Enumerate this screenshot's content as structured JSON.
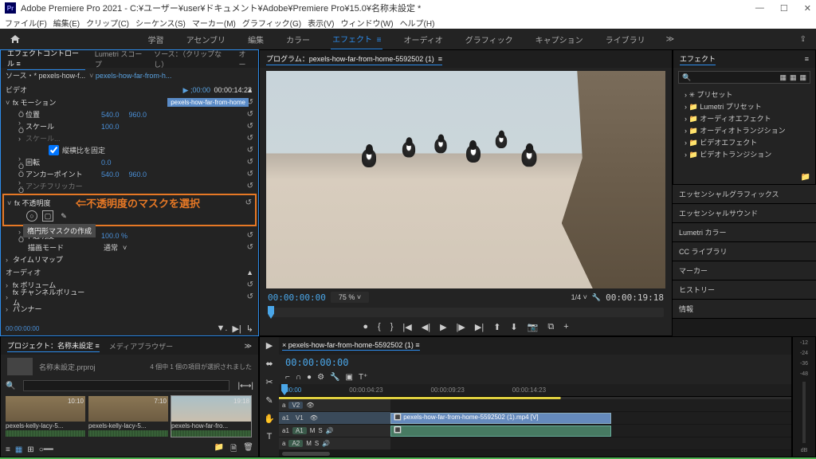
{
  "titlebar": {
    "app_icon": "Pr",
    "title": "Adobe Premiere Pro 2021 - C:¥ユーザー¥user¥ドキュメント¥Adobe¥Premiere Pro¥15.0¥名称未設定 *"
  },
  "menu": [
    "ファイル(F)",
    "編集(E)",
    "クリップ(C)",
    "シーケンス(S)",
    "マーカー(M)",
    "グラフィック(G)",
    "表示(V)",
    "ウィンドウ(W)",
    "ヘルプ(H)"
  ],
  "workspaces": {
    "items": [
      "学習",
      "アセンブリ",
      "編集",
      "カラー",
      "エフェクト",
      "オーディオ",
      "グラフィック",
      "キャプション",
      "ライブラリ"
    ],
    "active": "エフェクト"
  },
  "ec": {
    "tabs": [
      "エフェクトコントロール",
      "Lumetri スコープ",
      "ソース：（クリップなし）",
      "オー"
    ],
    "source_prefix": "ソース・* pexels-how-f...",
    "source_clip": "pexels-how-far-from-h...",
    "tc_start": "▶ ;00:00",
    "tc_end": "00:00:14:23",
    "clip_marker": "pexels-how-far-from-home",
    "video_hdr": "ビデオ",
    "motion": {
      "label": "fx モーション",
      "position": {
        "label": "位置",
        "x": "540.0",
        "y": "960.0"
      },
      "scale": {
        "label": "スケール",
        "value": "100.0"
      },
      "scale_w": {
        "label": "スケール...",
        "value": ""
      },
      "uniform": {
        "label": "縦横比を固定"
      },
      "rotation": {
        "label": "回転",
        "value": "0.0"
      },
      "anchor": {
        "label": "アンカーポイント",
        "x": "540.0",
        "y": "960.0"
      },
      "antiflicker": {
        "label": "アンチフリッカー",
        "value": ""
      }
    },
    "opacity": {
      "label": "fx 不透明度",
      "annotation": "⇐不透明度のマスクを選択",
      "tooltip": "楕円形マスクの作成",
      "value_label": "不透明度",
      "value": "100.0 %",
      "blend_label": "描画モード",
      "blend": "通常"
    },
    "timeremap": {
      "label": "タイムリマップ"
    },
    "audio_hdr": "オーディオ",
    "volume": {
      "label": "fx ボリューム"
    },
    "channel_volume": {
      "label": "fx チャンネルボリューム"
    },
    "panner": {
      "label": "パンナー"
    },
    "footer_tc": "00:00:00:00"
  },
  "program": {
    "tab": "プログラム：pexels-how-far-from-home-5592502 (1)",
    "tc_current": "00:00:00:00",
    "zoom": "75 %",
    "frac": "1/4",
    "tc_dur": "00:00:19:18"
  },
  "effects": {
    "tab": "エフェクト",
    "search_ph": "",
    "tree": [
      "プリセット",
      "Lumetri プリセット",
      "オーディオエフェクト",
      "オーディオトランジション",
      "ビデオエフェクト",
      "ビデオトランジション"
    ]
  },
  "side_panels": [
    "エッセンシャルグラフィックス",
    "エッセンシャルサウンド",
    "Lumetri カラー",
    "CC ライブラリ",
    "マーカー",
    "ヒストリー",
    "情報"
  ],
  "project": {
    "tabs": [
      "プロジェクト：名称未設定",
      "メディアブラウザー"
    ],
    "name": "名称未設定.prproj",
    "count": "4 個中 1 個の項目が選択されました",
    "clips": [
      {
        "name": "pexels-kelly-lacy-5...",
        "dur": "10:10"
      },
      {
        "name": "pexels-kelly-lacy-5...",
        "dur": "7:10"
      },
      {
        "name": "pexels-how-far-fro...",
        "dur": "19:18"
      }
    ]
  },
  "timeline": {
    "tab": "pexels-how-far-from-home-5592502 (1)",
    "tc": "00:00:00:00",
    "ruler": [
      ":00:00",
      "00:00:04:23",
      "00:00:09:23",
      "00:00:14:23"
    ],
    "tracks": {
      "v2": "V2",
      "v1": "V1",
      "a1": "A1",
      "a2": "A2",
      "btns": [
        "a1",
        "M",
        "S"
      ]
    },
    "clip_v": "pexels-how-far-from-home-5592502 (1).mp4 [V]"
  },
  "meters": {
    "labels": [
      "-12",
      "-24",
      "-36",
      "-48",
      "dB"
    ]
  }
}
